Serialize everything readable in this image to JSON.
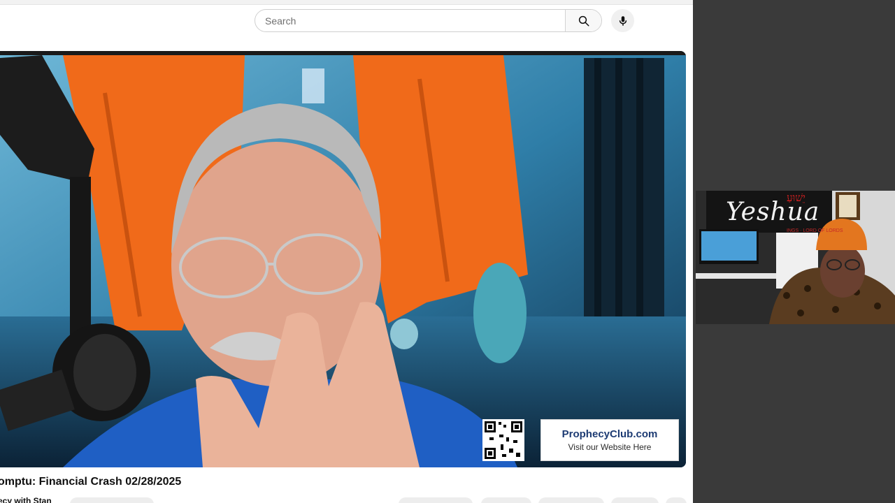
{
  "search": {
    "placeholder": "Search"
  },
  "icons": {
    "search": "search-icon",
    "mic": "microphone-icon"
  },
  "video": {
    "title": "omptu: Financial Crash 02/28/2025",
    "channel": "ecy with Stan",
    "sponsor_url": "ProphecyClub.com",
    "sponsor_sub": "Visit our Website Here"
  },
  "webcam": {
    "banner_text": "Yeshua",
    "hebrew_text": "יֵשׁוּעַ",
    "tagline": "INGS · LORD OF LORDS"
  },
  "colors": {
    "page_background": "#3a3a3a",
    "prison_jumpsuit": "#f06a1a",
    "sponsor_text": "#1d3b73"
  }
}
